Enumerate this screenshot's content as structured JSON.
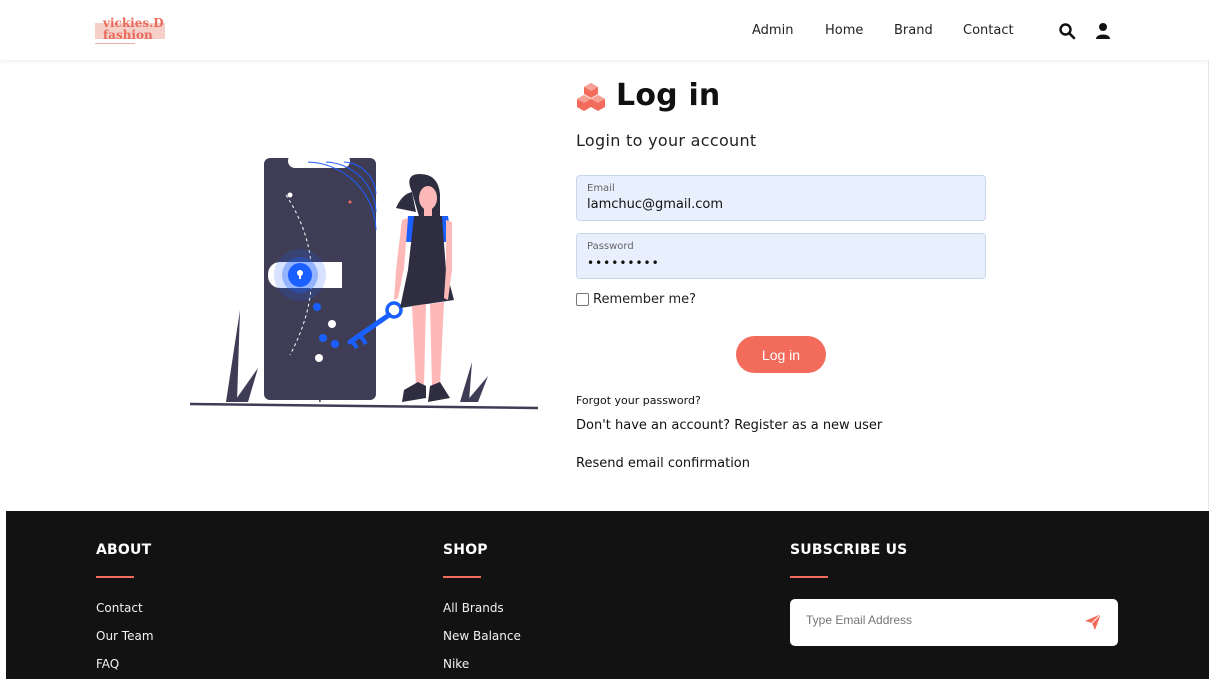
{
  "header": {
    "logo": {
      "line1": "vickies.D",
      "line2": "fashion"
    },
    "nav": [
      {
        "label": "Admin"
      },
      {
        "label": "Home"
      },
      {
        "label": "Brand"
      },
      {
        "label": "Contact"
      }
    ],
    "icons": [
      "search-icon",
      "user-icon"
    ]
  },
  "login": {
    "title": "Log in",
    "subtitle": "Login to your account",
    "email": {
      "label": "Email",
      "value": "lamchuc@gmail.com"
    },
    "password": {
      "label": "Password",
      "value": "•••••••••"
    },
    "remember_label": "Remember me?",
    "button_label": "Log in",
    "forgot_link": "Forgot your password?",
    "register_link": "Don't have an account? Register as a new user",
    "resend_link": "Resend email confirmation"
  },
  "footer": {
    "about": {
      "heading": "ABOUT",
      "links": [
        "Contact",
        "Our Team",
        "FAQ"
      ]
    },
    "shop": {
      "heading": "SHOP",
      "links": [
        "All Brands",
        "New Balance",
        "Nike"
      ]
    },
    "subscribe": {
      "heading": "SUBSCRIBE US",
      "placeholder": "Type Email Address"
    }
  },
  "colors": {
    "accent": "#f26b5b",
    "input_bg": "#e8f0fe",
    "footer_bg": "#131212",
    "illustration_dark": "#3f3d56",
    "illustration_blue": "#1a5fff"
  }
}
